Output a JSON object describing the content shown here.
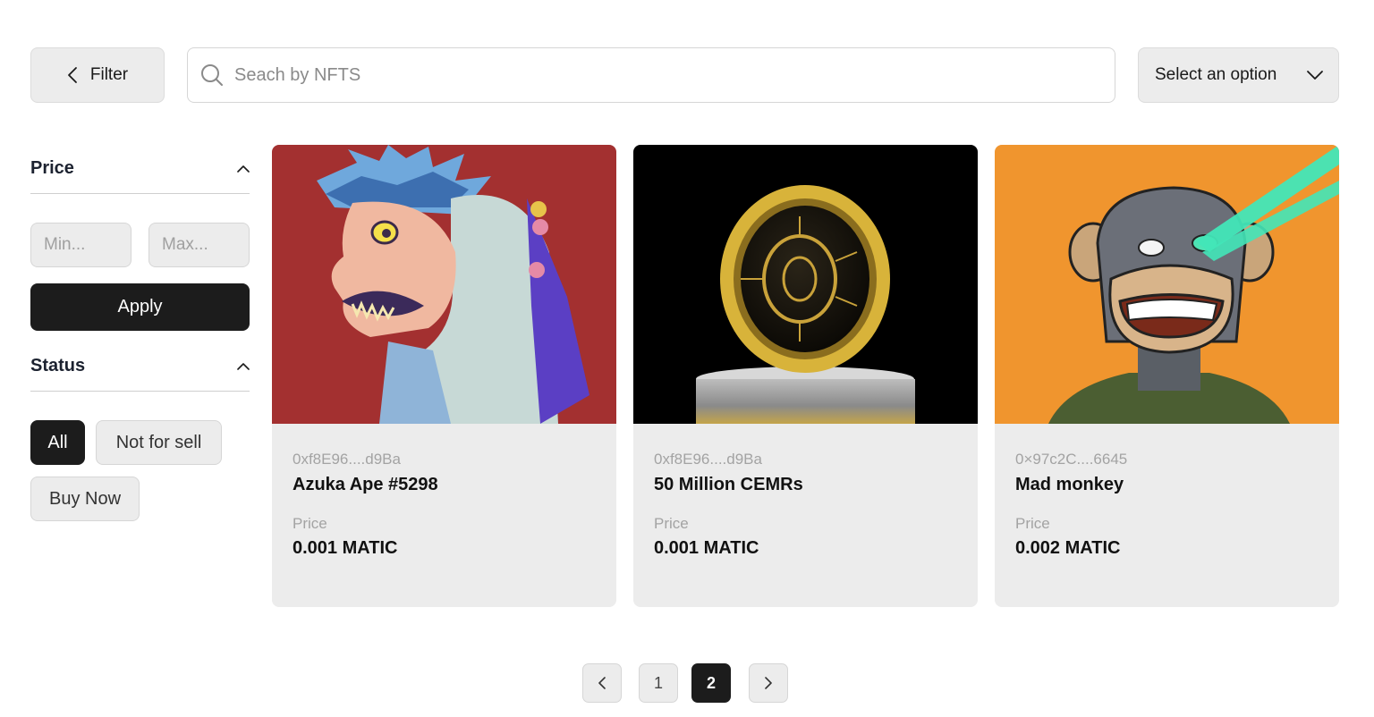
{
  "toolbar": {
    "filter_label": "Filter",
    "search_placeholder": "Seach by NFTS",
    "search_value": "",
    "select_label": "Select an option"
  },
  "sidebar": {
    "price": {
      "title": "Price",
      "min_placeholder": "Min...",
      "max_placeholder": "Max...",
      "apply_label": "Apply"
    },
    "status": {
      "title": "Status",
      "options": [
        {
          "label": "All",
          "active": true
        },
        {
          "label": "Not for sell",
          "active": false
        },
        {
          "label": "Buy Now",
          "active": false
        }
      ]
    }
  },
  "cards": [
    {
      "address": "0xf8E96....d9Ba",
      "name": "Azuka Ape #5298",
      "price_label": "Price",
      "price": "0.001 MATIC",
      "bg_color": "#a33030"
    },
    {
      "address": "0xf8E96....d9Ba",
      "name": "50 Million CEMRs",
      "price_label": "Price",
      "price": "0.001 MATIC",
      "bg_color": "#000000"
    },
    {
      "address": "0×97c2C....6645",
      "name": "Mad monkey",
      "price_label": "Price",
      "price": "0.002 MATIC",
      "bg_color": "#f0952e"
    }
  ],
  "pagination": {
    "pages": [
      "1",
      "2"
    ],
    "current": "2"
  },
  "colors": {
    "accent_dark": "#1c1c1c",
    "surface": "#ececec",
    "muted_text": "#a3a3a3"
  }
}
